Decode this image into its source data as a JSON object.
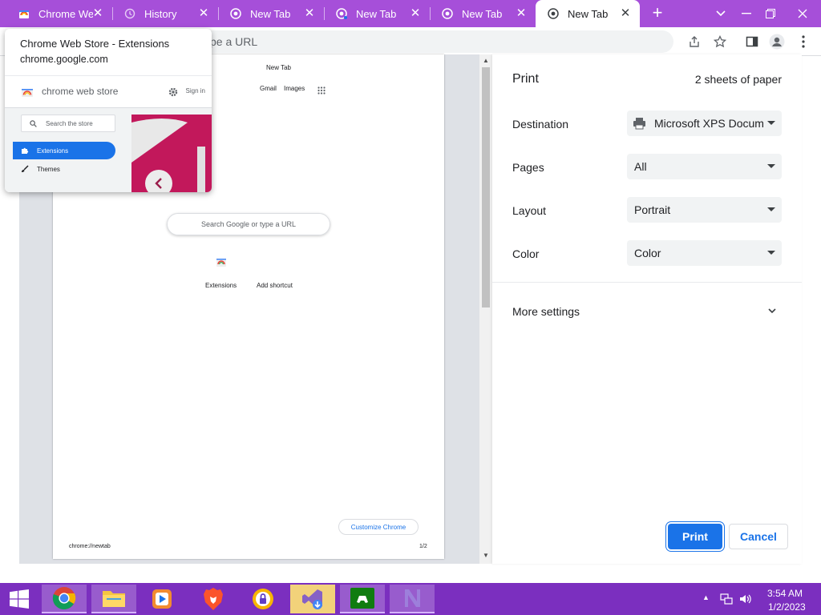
{
  "tabs": [
    {
      "title": "Chrome Web",
      "icon": "chrome-web-store-icon",
      "active": false
    },
    {
      "title": "History",
      "icon": "history-icon",
      "active": false
    },
    {
      "title": "New Tab",
      "icon": "chrome-icon",
      "active": false
    },
    {
      "title": "New Tab",
      "icon": "chrome-icon",
      "active": false
    },
    {
      "title": "New Tab",
      "icon": "chrome-icon",
      "active": false
    },
    {
      "title": "New Tab",
      "icon": "chrome-icon",
      "active": true
    }
  ],
  "toolbar": {
    "omnibox_text": "pe a URL"
  },
  "hovercard": {
    "title": "Chrome Web Store - Extensions",
    "domain": "chrome.google.com",
    "thumbnail": {
      "store_name": "chrome web store",
      "sign_in": "Sign in",
      "search_placeholder": "Search the store",
      "nav_extensions": "Extensions",
      "nav_themes": "Themes"
    }
  },
  "preview": {
    "page_title": "New Tab",
    "gmail": "Gmail",
    "images": "Images",
    "search_placeholder": "Search Google or type a URL",
    "shortcut_extensions": "Extensions",
    "shortcut_add": "Add shortcut",
    "customize": "Customize Chrome",
    "footer_url": "chrome://newtab",
    "footer_page": "1/2"
  },
  "print": {
    "title": "Print",
    "sheets": "2 sheets of paper",
    "destination_label": "Destination",
    "destination_value": "Microsoft XPS Docum",
    "pages_label": "Pages",
    "pages_value": "All",
    "layout_label": "Layout",
    "layout_value": "Portrait",
    "color_label": "Color",
    "color_value": "Color",
    "more_settings": "More settings",
    "print_button": "Print",
    "cancel_button": "Cancel"
  },
  "taskbar": {
    "apps": [
      "chrome",
      "file-explorer",
      "media-player",
      "brave",
      "vpn",
      "visual-studio-installer",
      "xbox",
      "visual-studio"
    ],
    "time": "3:54 AM",
    "date": "1/2/2023"
  },
  "colors": {
    "accent": "#1a73e8",
    "tabstrip": "#a64fd9",
    "taskbar": "#7b2fbf"
  }
}
